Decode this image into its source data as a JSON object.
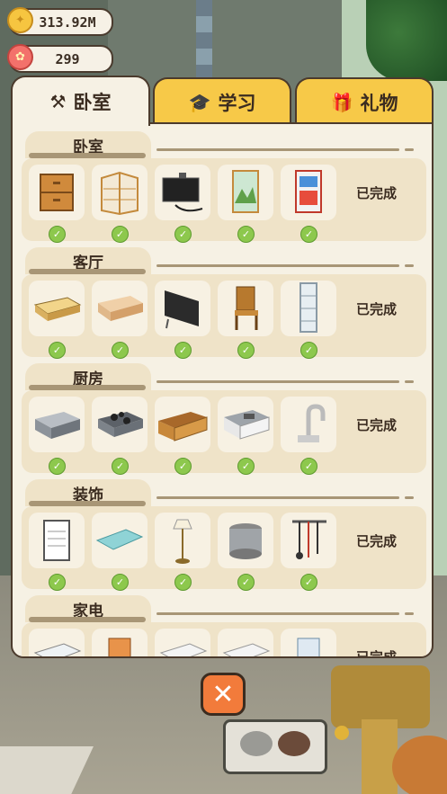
{
  "currency": {
    "coins": "313.92M",
    "flowers": "299"
  },
  "tabs": [
    {
      "label": "卧室",
      "icon": "hammer-icon",
      "active": true
    },
    {
      "label": "学习",
      "icon": "graduation-cap-icon",
      "active": false
    },
    {
      "label": "礼物",
      "icon": "gift-icon",
      "active": false
    }
  ],
  "sections": [
    {
      "title": "卧室",
      "status": "已完成",
      "items": [
        "nightstand-icon",
        "corner-shelf-icon",
        "tv-icon",
        "window-painting-icon",
        "poster-icon"
      ]
    },
    {
      "title": "客厅",
      "status": "已完成",
      "items": [
        "coffee-table-icon",
        "tv-cabinet-icon",
        "tv-screen-icon",
        "wooden-chair-icon",
        "glass-shelf-icon"
      ]
    },
    {
      "title": "厨房",
      "status": "已完成",
      "items": [
        "counter-icon",
        "stove-icon",
        "cabinet-icon",
        "sink-counter-icon",
        "faucet-icon"
      ]
    },
    {
      "title": "装饰",
      "status": "已完成",
      "items": [
        "clipboard-icon",
        "mat-icon",
        "floor-lamp-icon",
        "pot-icon",
        "utensil-rack-icon"
      ]
    },
    {
      "title": "家电",
      "status": "已完成",
      "items": [
        "appliance-1-icon",
        "appliance-2-icon",
        "appliance-3-icon",
        "appliance-4-icon",
        "appliance-5-icon"
      ]
    }
  ],
  "close_label": "✕"
}
